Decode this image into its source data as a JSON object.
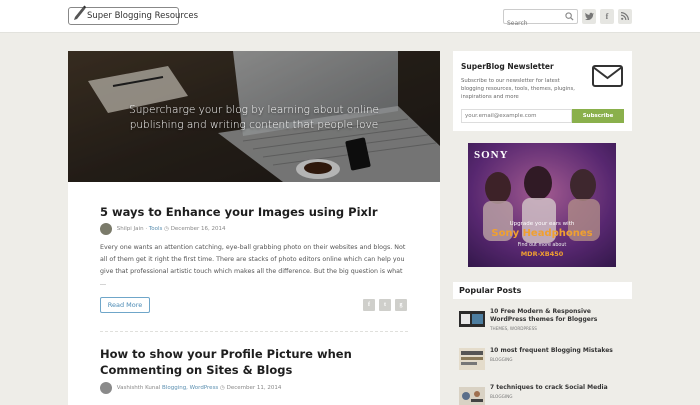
{
  "header": {
    "logo_text": "Super Blogging Resources",
    "search_placeholder": "Search",
    "social": [
      "twitter-icon",
      "facebook-icon",
      "rss-icon"
    ],
    "social_glyphs": [
      "𝕋",
      "f",
      "◔"
    ]
  },
  "hero": {
    "tagline": "Supercharge your blog by learning about online publishing and writing content that people love"
  },
  "posts": [
    {
      "title": "5 ways to Enhance your Images using Pixlr",
      "author": "Shilpi Jain",
      "category": "Tools",
      "date": "December 16, 2014",
      "excerpt": "Every one wants an attention catching, eye-ball grabbing photo on their websites and blogs. Not all of them get it right the first time. There are stacks of photo editors online which can help you give that professional artistic touch which makes all the difference. But the big question is what ...",
      "read_more": "Read More"
    },
    {
      "title": "How to show your Profile Picture when Commenting on Sites & Blogs",
      "author": "Vashishth Kunal",
      "category": "Blogging, WordPress",
      "date": "December 11, 2014"
    }
  ],
  "newsletter": {
    "title": "SuperBlog Newsletter",
    "text": "Subscribe to our newsletter for latest blogging resources, tools, themes, plugins, inspirations and more",
    "input_placeholder": "your.email@example.com",
    "button": "Subscribe"
  },
  "ad": {
    "brand": "SONY",
    "line1": "Upgrade your ears with",
    "line2": "Sony Headphones",
    "line3": "Find out more about",
    "model": "MDR-XB450"
  },
  "popular": {
    "heading": "Popular Posts",
    "items": [
      {
        "title": "10 Free Modern & Responsive WordPress themes for Bloggers",
        "category": "THEMES, WORDPRESS"
      },
      {
        "title": "10 most frequent Blogging Mistakes",
        "category": "BLOGGING"
      },
      {
        "title": "7 techniques to crack Social Media",
        "category": "BLOGGING"
      }
    ]
  },
  "colors": {
    "background": "#eeede8",
    "accent_blue": "#4c8bb5",
    "subscribe_green": "#8ab04c"
  }
}
